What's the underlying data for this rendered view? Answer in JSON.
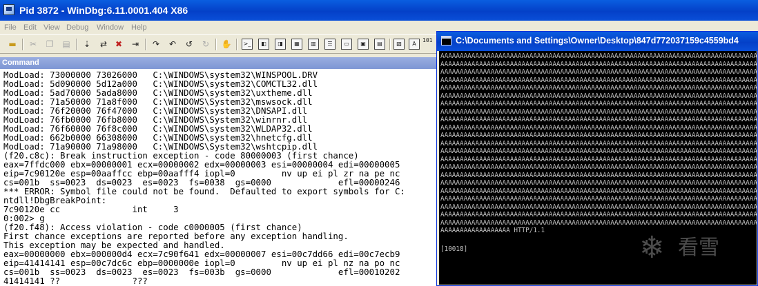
{
  "windbg": {
    "title": "Pid 3872 - WinDbg:6.11.0001.404 X86",
    "menu": [
      "File",
      "Edit",
      "View",
      "Debug",
      "Window",
      "Help"
    ],
    "toolbar_number_label": "101\n101"
  },
  "command_window": {
    "title": "Command",
    "lines": [
      "ModLoad: 73000000 73026000   C:\\WINDOWS\\system32\\WINSPOOL.DRV",
      "ModLoad: 5d090000 5d12a000   C:\\WINDOWS\\system32\\COMCTL32.dll",
      "ModLoad: 5ad70000 5ada8000   C:\\WINDOWS\\system32\\uxtheme.dll",
      "ModLoad: 71a50000 71a8f000   C:\\WINDOWS\\System32\\mswsock.dll",
      "ModLoad: 76f20000 76f47000   C:\\WINDOWS\\system32\\DNSAPI.dll",
      "ModLoad: 76fb0000 76fb8000   C:\\WINDOWS\\System32\\winrnr.dll",
      "ModLoad: 76f60000 76f8c000   C:\\WINDOWS\\system32\\WLDAP32.dll",
      "ModLoad: 662b0000 66308000   C:\\WINDOWS\\system32\\hnetcfg.dll",
      "ModLoad: 71a90000 71a98000   C:\\WINDOWS\\System32\\wshtcpip.dll",
      "(f20.c8c): Break instruction exception - code 80000003 (first chance)",
      "eax=7ffdc000 ebx=00000001 ecx=00000002 edx=00000003 esi=00000004 edi=00000005",
      "eip=7c90120e esp=00aaffcc ebp=00aafff4 iopl=0         nv up ei pl zr na pe nc",
      "cs=001b  ss=0023  ds=0023  es=0023  fs=0038  gs=0000             efl=00000246",
      "*** ERROR: Symbol file could not be found.  Defaulted to export symbols for C:",
      "ntdll!DbgBreakPoint:",
      "7c90120e cc              int     3",
      "0:002> g",
      "(f20.f48): Access violation - code c0000005 (first chance)",
      "First chance exceptions are reported before any exception handling.",
      "This exception may be expected and handled.",
      "eax=00000000 ebx=000000d4 ecx=7c90f641 edx=00000007 esi=00c7dd66 edi=00c7ecb9",
      "eip=41414141 esp=00c7dc6c ebp=0000000e iopl=0         nv up ei pl nz na po nc",
      "cs=001b  ss=0023  ds=0023  es=0023  fs=003b  gs=0000             efl=00010202",
      "41414141 ??              ???"
    ]
  },
  "console_window": {
    "title": "C:\\Documents and Settings\\Owner\\Desktop\\847d772037159c4559bd4",
    "a_line": "AAAAAAAAAAAAAAAAAAAAAAAAAAAAAAAAAAAAAAAAAAAAAAAAAAAAAAAAAAAAAAAAAAAAAAAAAAAAAAAAAAAAAAAA",
    "a_line_count": 22,
    "final_line": "AAAAAAAAAAAAAAAAAA HTTP/1.1",
    "status_line": "[10018]"
  },
  "watermark": {
    "icon": "snowflake-icon",
    "text": "看雪"
  }
}
